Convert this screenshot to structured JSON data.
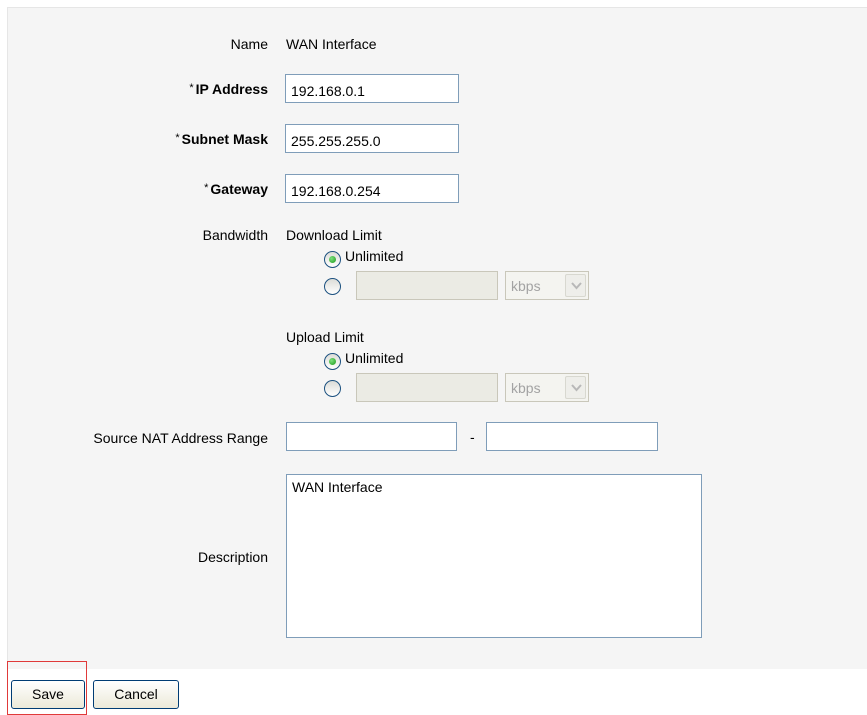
{
  "form": {
    "name_label": "Name",
    "name_value": "WAN Interface",
    "required_marker": "*",
    "ip_label": "IP Address",
    "ip_value": "192.168.0.1",
    "subnet_label": "Subnet Mask",
    "subnet_value": "255.255.255.0",
    "gateway_label": "Gateway",
    "gateway_value": "192.168.0.254",
    "bandwidth_label": "Bandwidth",
    "download": {
      "title": "Download Limit",
      "unlimited_label": "Unlimited",
      "selected": "unlimited",
      "limit_value": "",
      "unit": "kbps"
    },
    "upload": {
      "title": "Upload Limit",
      "unlimited_label": "Unlimited",
      "selected": "unlimited",
      "limit_value": "",
      "unit": "kbps"
    },
    "nat_label": "Source NAT Address Range",
    "nat_start": "",
    "nat_separator": "-",
    "nat_end": "",
    "description_label": "Description",
    "description_value": "WAN Interface"
  },
  "buttons": {
    "save": "Save",
    "cancel": "Cancel"
  },
  "icons": {
    "radio_selected": "radio-selected-icon",
    "radio_unselected": "radio-unselected-icon",
    "dropdown": "chevron-down-icon"
  },
  "colors": {
    "panel_bg": "#f5f5f5",
    "input_border": "#7f9db9",
    "radio_dot": "#1b9a1b",
    "focus_outline": "#e03a3a"
  }
}
